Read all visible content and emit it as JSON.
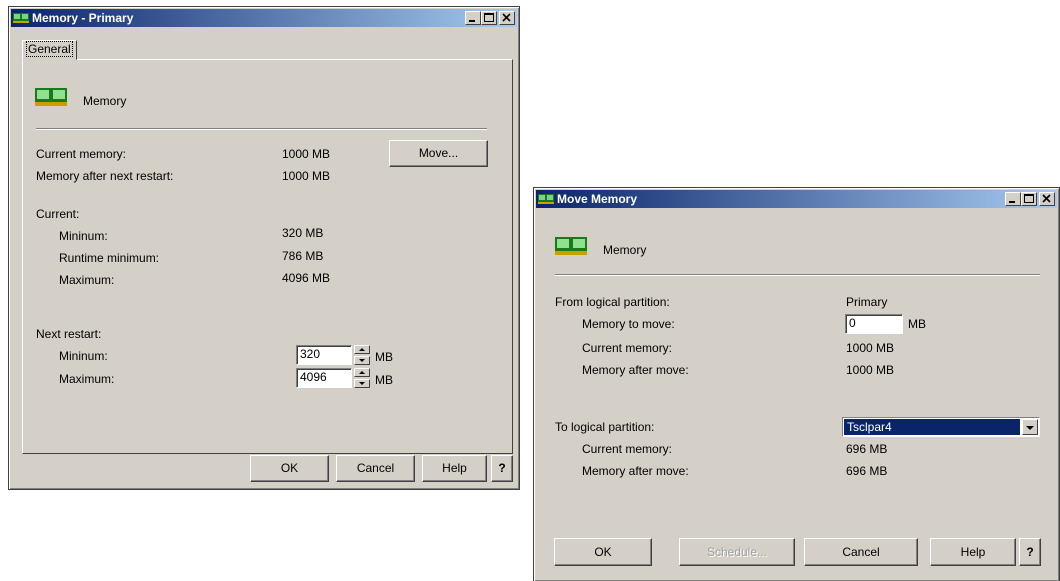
{
  "primary_window": {
    "title": "Memory - Primary",
    "tab_label": "General",
    "section_label": "Memory",
    "current_memory_label": "Current memory:",
    "current_memory_value": "1000 MB",
    "after_restart_label": "Memory after next restart:",
    "after_restart_value": "1000 MB",
    "move_button": "Move...",
    "current_header": "Current:",
    "cur_min_label": "Mininum:",
    "cur_min_value": "320 MB",
    "cur_runtime_label": "Runtime minimum:",
    "cur_runtime_value": "786 MB",
    "cur_max_label": "Maximum:",
    "cur_max_value": "4096 MB",
    "next_header": "Next restart:",
    "next_min_label": "Mininum:",
    "next_min_value": "320",
    "next_min_unit": "MB",
    "next_max_label": "Maximum:",
    "next_max_value": "4096",
    "next_max_unit": "MB",
    "ok_button": "OK",
    "cancel_button": "Cancel",
    "help_button": "Help",
    "whatsthis_button": "?"
  },
  "move_window": {
    "title": "Move Memory",
    "section_label": "Memory",
    "from_label": "From logical partition:",
    "from_value": "Primary",
    "to_move_label": "Memory to move:",
    "to_move_value": "0",
    "to_move_unit": "MB",
    "from_current_label": "Current memory:",
    "from_current_value": "1000 MB",
    "from_after_label": "Memory after move:",
    "from_after_value": "1000 MB",
    "to_label": "To logical partition:",
    "to_selected": "Tsclpar4",
    "to_current_label": "Current memory:",
    "to_current_value": "696 MB",
    "to_after_label": "Memory after move:",
    "to_after_value": "696 MB",
    "ok_button": "OK",
    "schedule_button": "Schedule...",
    "cancel_button": "Cancel",
    "help_button": "Help",
    "whatsthis_button": "?"
  },
  "colors": {
    "titlebar_start": "#0a246a",
    "titlebar_end": "#a6caf0",
    "dialog_face": "#d4d0c8",
    "selection": "#0a246a"
  },
  "icons": [
    "memory-module-icon",
    "minimize-icon",
    "maximize-icon",
    "close-icon",
    "spin-up-icon",
    "spin-down-icon",
    "dropdown-arrow-icon"
  ]
}
